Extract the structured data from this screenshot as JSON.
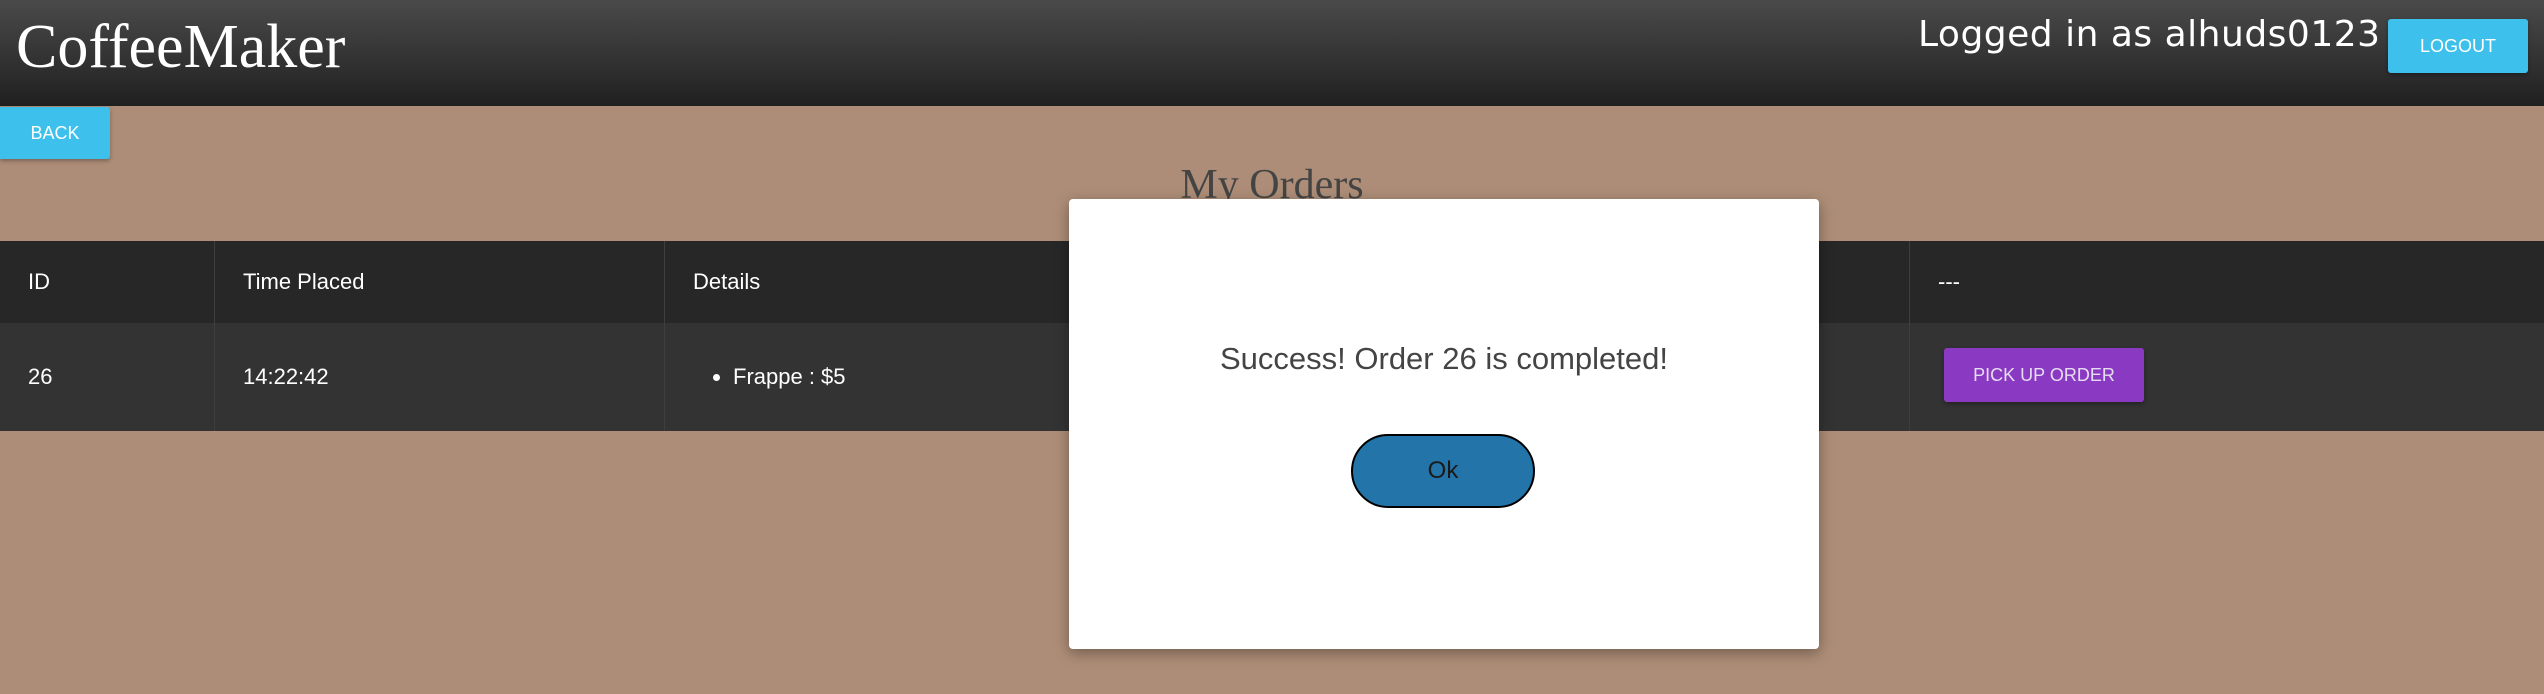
{
  "navbar": {
    "brand": "CoffeeMaker",
    "logged_in_text": "Logged in as alhuds0123",
    "logout_label": "LOGOUT"
  },
  "back_label": "BACK",
  "page_title": "My Orders",
  "table": {
    "headers": [
      "ID",
      "Time Placed",
      "Details",
      "---"
    ],
    "rows": [
      {
        "id": "26",
        "time": "14:22:42",
        "details": [
          "Frappe : $5"
        ],
        "action_label": "PICK UP ORDER"
      }
    ]
  },
  "modal": {
    "message": "Success! Order 26 is completed!",
    "ok_label": "Ok"
  },
  "colors": {
    "background": "#ad8d77",
    "accent_blue": "#3dc0ec",
    "pickup_purple": "#8a3ac2",
    "ok_blue": "#2374a8"
  }
}
